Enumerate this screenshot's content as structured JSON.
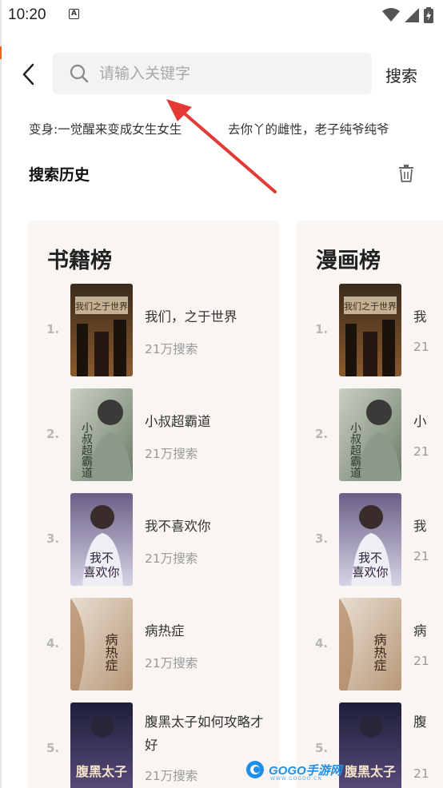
{
  "status_bar": {
    "time": "10:20",
    "notification_glyph": "A"
  },
  "search": {
    "placeholder": "请输入关键字",
    "button_label": "搜索"
  },
  "hot_words": [
    "变身:一觉醒来变成女生女生",
    "去你丫的雌性，老子纯爷纯爷"
  ],
  "history": {
    "title": "搜索历史"
  },
  "rankings": [
    {
      "title": "书籍榜",
      "items": [
        {
          "rank": "1.",
          "title": "我们，之于世界",
          "count": "21万搜索"
        },
        {
          "rank": "2.",
          "title": "小叔超霸道",
          "count": "21万搜索"
        },
        {
          "rank": "3.",
          "title": "我不喜欢你",
          "count": "21万搜索"
        },
        {
          "rank": "4.",
          "title": "病热症",
          "count": "21万搜索"
        },
        {
          "rank": "5.",
          "title": "腹黑太子如何攻略才好",
          "count": "21万搜索"
        }
      ]
    },
    {
      "title": "漫画榜",
      "items": [
        {
          "rank": "1.",
          "title": "我",
          "count": "21"
        },
        {
          "rank": "2.",
          "title": "小",
          "count": "21"
        },
        {
          "rank": "3.",
          "title": "我",
          "count": "21"
        },
        {
          "rank": "4.",
          "title": "病",
          "count": "21"
        },
        {
          "rank": "5.",
          "title": "腹",
          "count": "21"
        }
      ]
    }
  ],
  "covers": [
    {
      "text": "我们之于世界",
      "colors": [
        "#3a2a1c",
        "#8a5a2c"
      ]
    },
    {
      "text": "小叔超霸道",
      "colors": [
        "#c9cfc2",
        "#6f7d6a"
      ]
    },
    {
      "text": "我不喜欢你",
      "colors": [
        "#6a5f86",
        "#d7d3e6"
      ]
    },
    {
      "text": "病热症",
      "colors": [
        "#e8ded2",
        "#b89878"
      ]
    },
    {
      "text": "腹黑太子",
      "colors": [
        "#1d1f3a",
        "#5c4d7e"
      ]
    }
  ],
  "watermark": {
    "brand": "GOGO手游网",
    "url": "WWW.GOGOO.CN"
  },
  "colors": {
    "accent_arrow": "#e53935",
    "card_bg": "#f8f5f2",
    "search_bg": "#f3f3f3",
    "watermark_blue": "#1f8fe8"
  }
}
